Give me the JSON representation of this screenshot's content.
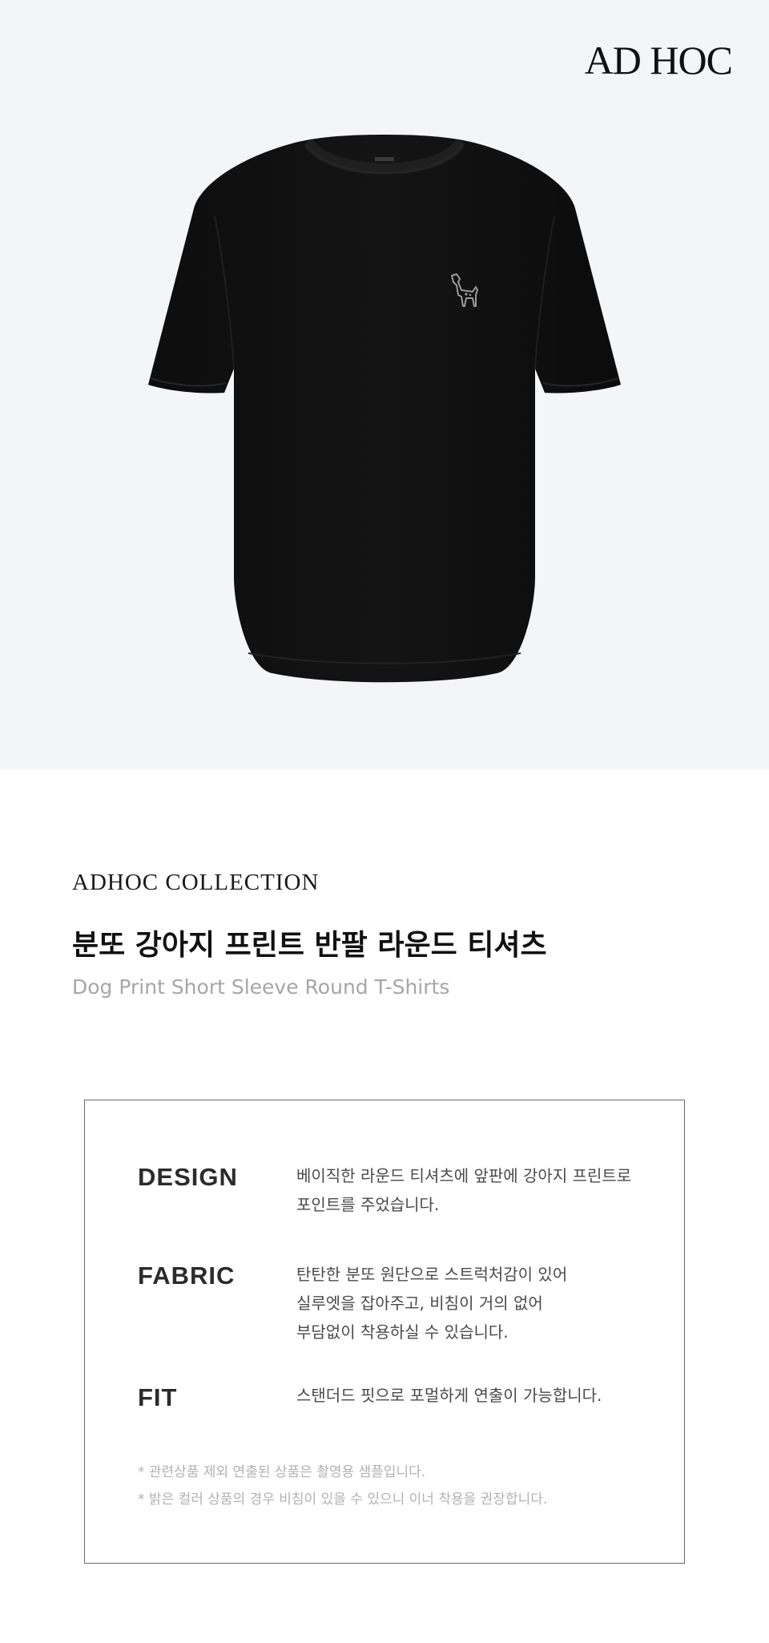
{
  "brand": {
    "logo_text": "AD HOC"
  },
  "hero": {
    "product_image": "black-round-tshirt-with-dog-print"
  },
  "product": {
    "collection": "ADHOC COLLECTION",
    "title_ko": "분또 강아지 프린트 반팔 라운드 티셔츠",
    "title_en": "Dog Print Short Sleeve Round T-Shirts"
  },
  "specs": {
    "design": {
      "label": "DESIGN",
      "lines": [
        "베이직한 라운드 티셔츠에 앞판에 강아지 프린트로",
        "포인트를 주었습니다."
      ]
    },
    "fabric": {
      "label": "FABRIC",
      "lines": [
        "탄탄한 분또 원단으로 스트럭처감이 있어",
        "실루엣을 잡아주고, 비침이 거의 없어",
        "부담없이 착용하실 수 있습니다."
      ]
    },
    "fit": {
      "label": "FIT",
      "lines": [
        "스탠더드 핏으로 포멀하게 연출이 가능합니다."
      ]
    }
  },
  "notes": [
    "* 관련상품 제외 연출된 상품은 촬영용 샘플입니다.",
    "* 밝은 컬러 상품의 경우 비침이 있을 수 있으니 이너 착용을 권장합니다."
  ],
  "colors": {
    "hero_bg": "#f4f5f7",
    "shirt": "#111111",
    "muted_text": "#a6a6a6"
  }
}
